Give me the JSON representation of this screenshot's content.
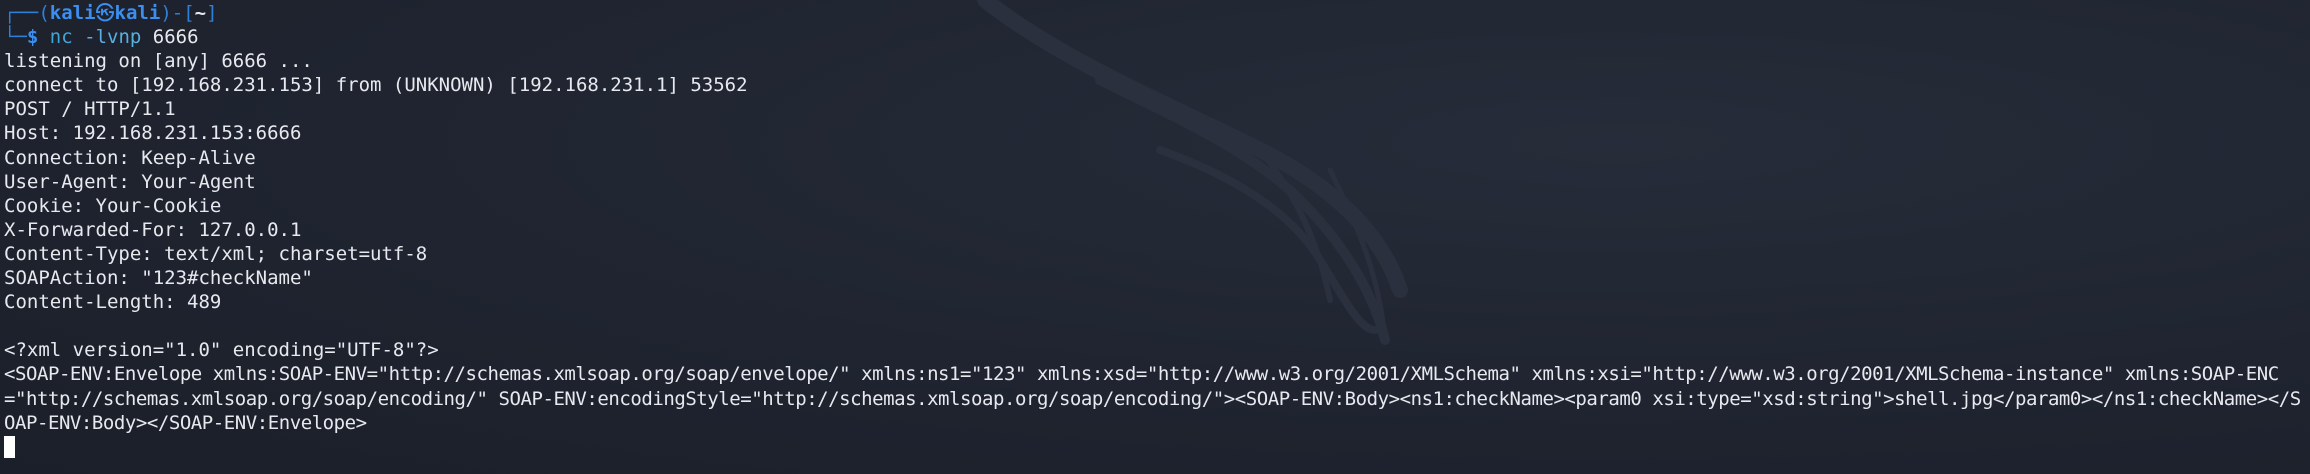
{
  "prompt": {
    "frame_open": "┌──(",
    "user": "kali",
    "skull_glyph": "㉿",
    "host": "kali",
    "frame_mid": ")-[",
    "path": "~",
    "frame_close": "]",
    "frame_bottom": "└─",
    "dollar": "$",
    "command": "nc",
    "flag": "-lvnp",
    "port": "6666"
  },
  "output": {
    "lines": [
      "listening on [any] 6666 ...",
      "connect to [192.168.231.153] from (UNKNOWN) [192.168.231.1] 53562",
      "POST / HTTP/1.1",
      "Host: 192.168.231.153:6666",
      "Connection: Keep-Alive",
      "User-Agent: Your-Agent",
      "Cookie: Your-Cookie",
      "X-Forwarded-For: 127.0.0.1",
      "Content-Type: text/xml; charset=utf-8",
      "SOAPAction: \"123#checkName\"",
      "Content-Length: 489",
      "",
      "<?xml version=\"1.0\" encoding=\"UTF-8\"?>"
    ],
    "soap_body": "<SOAP-ENV:Envelope xmlns:SOAP-ENV=\"http://schemas.xmlsoap.org/soap/envelope/\" xmlns:ns1=\"123\" xmlns:xsd=\"http://www.w3.org/2001/XMLSchema\" xmlns:xsi=\"http://www.w3.org/2001/XMLSchema-instance\" xmlns:SOAP-ENC=\"http://schemas.xmlsoap.org/soap/encoding/\" SOAP-ENV:encodingStyle=\"http://schemas.xmlsoap.org/soap/encoding/\"><SOAP-ENV:Body><ns1:checkName><param0 xsi:type=\"xsd:string\">shell.jpg</param0></ns1:checkName></SOAP-ENV:Body></SOAP-ENV:Envelope>"
  },
  "colors": {
    "background": "#1f2430",
    "prompt_accent": "#3b8ff0",
    "command": "#3ea6d8",
    "text": "#e7e9ee",
    "cursor": "#ffffff"
  },
  "icons": {
    "background_logo": "kali-dragon-logo-watermark",
    "cursor": "block-cursor"
  }
}
